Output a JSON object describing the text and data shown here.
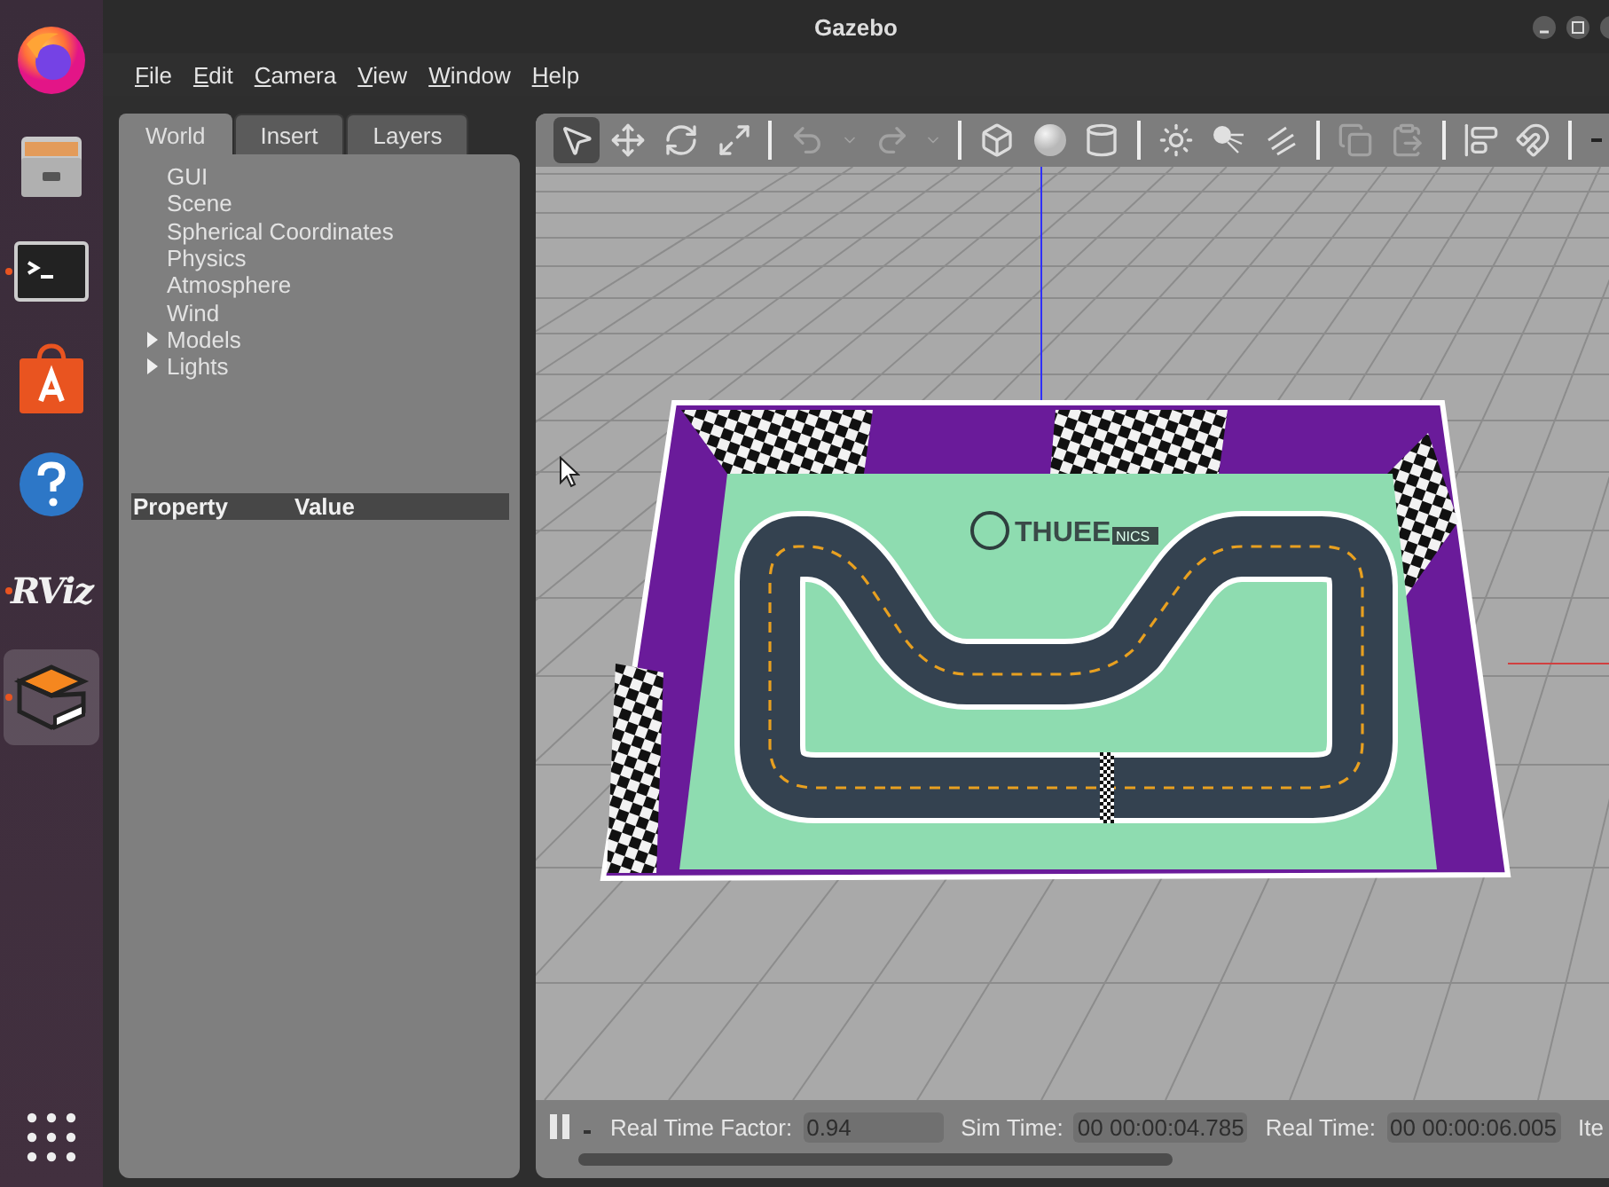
{
  "window": {
    "title": "Gazebo"
  },
  "dock": {
    "items": [
      {
        "kind": "browser",
        "running": false,
        "active": false
      },
      {
        "kind": "files",
        "running": false,
        "active": false
      },
      {
        "kind": "terminal",
        "running": true,
        "active": false
      },
      {
        "kind": "store",
        "running": false,
        "active": false
      },
      {
        "kind": "help",
        "running": false,
        "active": false
      },
      {
        "kind": "logo",
        "label": "RViz",
        "running": true,
        "active": false
      },
      {
        "kind": "simulator",
        "running": true,
        "active": true
      }
    ]
  },
  "menu": [
    "File",
    "Edit",
    "Camera",
    "View",
    "Window",
    "Help"
  ],
  "left_panel": {
    "tabs": [
      {
        "label": "World",
        "selected": true
      },
      {
        "label": "Insert",
        "selected": false
      },
      {
        "label": "Layers",
        "selected": false
      }
    ],
    "tree": [
      {
        "label": "GUI",
        "kind": "leaf"
      },
      {
        "label": "Scene",
        "kind": "leaf"
      },
      {
        "label": "Spherical Coordinates",
        "kind": "leaf"
      },
      {
        "label": "Physics",
        "kind": "leaf"
      },
      {
        "label": "Atmosphere",
        "kind": "leaf"
      },
      {
        "label": "Wind",
        "kind": "leaf"
      },
      {
        "label": "Models",
        "kind": "group",
        "expanded": false
      },
      {
        "label": "Lights",
        "kind": "group",
        "expanded": false
      }
    ],
    "property_table": {
      "columns": [
        "Property",
        "Value"
      ]
    }
  },
  "toolbar": {
    "modes": [
      {
        "selected": true
      },
      {
        "selected": false
      },
      {
        "selected": false
      },
      {
        "selected": false
      }
    ],
    "history_enabled": false,
    "clipboard_enabled": false
  },
  "scene": {
    "logo": {
      "name": "THUEE",
      "tag": "NICS"
    }
  },
  "status_bar": {
    "paused": false,
    "fields": [
      {
        "label": "Real Time Factor:",
        "value": "0.94"
      },
      {
        "label": "Sim Time:",
        "value": "00 00:00:04.785"
      },
      {
        "label": "Real Time:",
        "value": "00 00:00:06.005"
      }
    ],
    "cut_label": "Ite"
  }
}
